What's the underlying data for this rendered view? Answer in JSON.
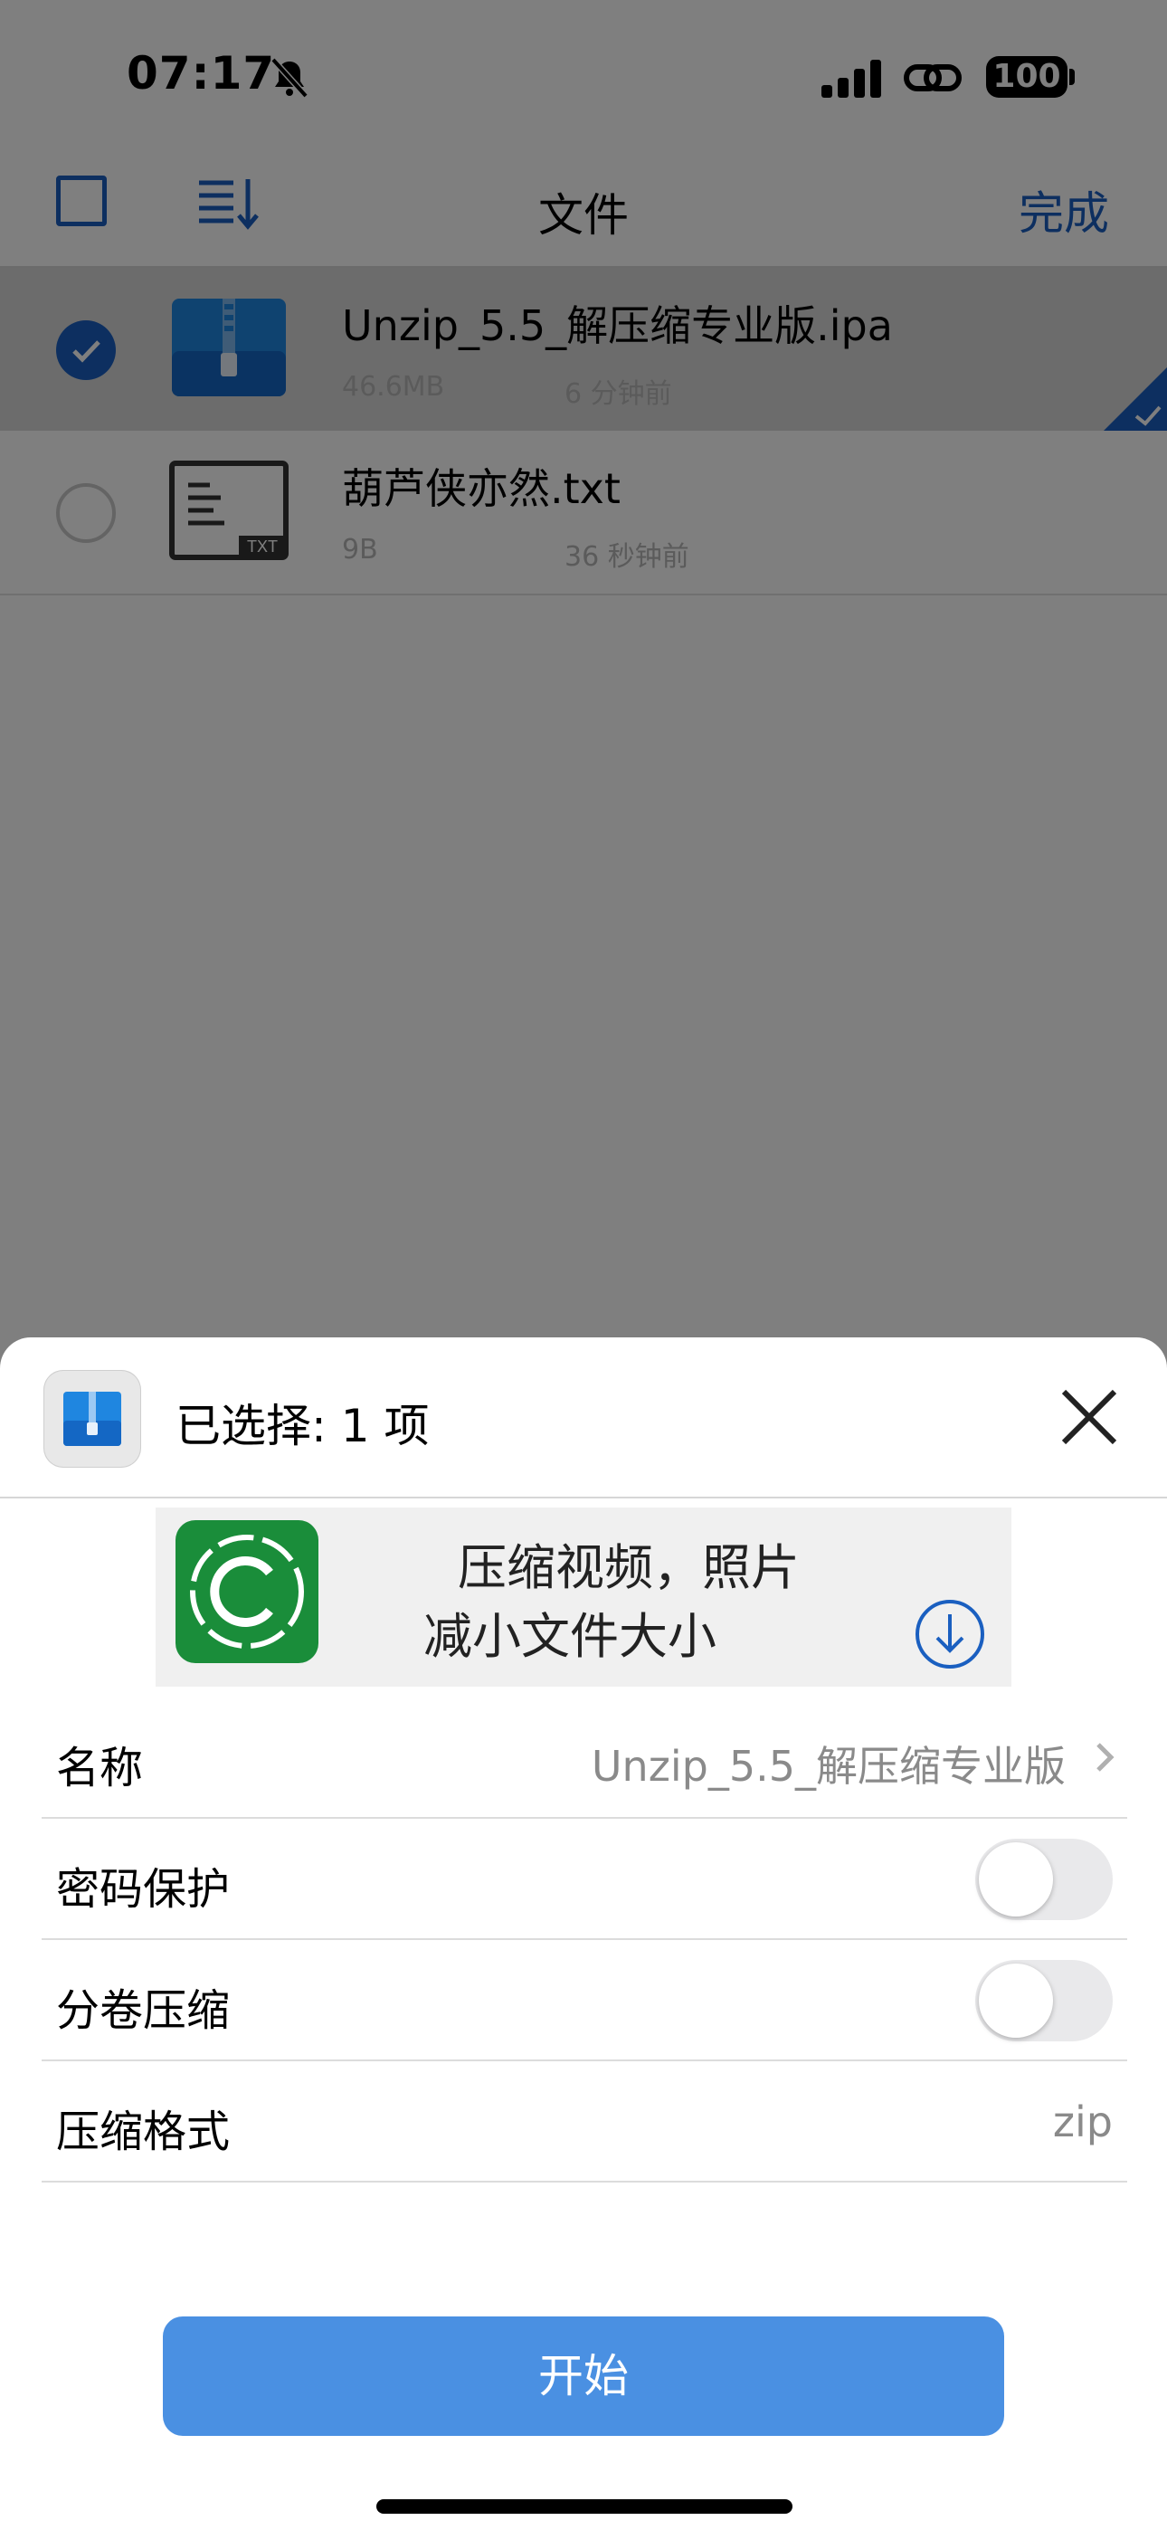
{
  "status_bar": {
    "time": "07:17",
    "battery": "100"
  },
  "nav": {
    "title": "文件",
    "done_label": "完成"
  },
  "files": [
    {
      "name": "Unzip_5.5_解压缩专业版.ipa",
      "size": "46.6MB",
      "modified": "6 分钟前",
      "selected": true,
      "icon": "zip-file-icon"
    },
    {
      "name": "葫芦侠亦然.txt",
      "size": "9B",
      "modified": "36 秒钟前",
      "selected": false,
      "icon": "txt-file-icon",
      "icon_badge": "TXT"
    }
  ],
  "sheet": {
    "title": "已选择: 1 项",
    "ad": {
      "line1": "压缩视频，照片",
      "line2": "减小文件大小"
    },
    "settings": {
      "name": {
        "label": "名称",
        "value": "Unzip_5.5_解压缩专业版"
      },
      "password": {
        "label": "密码保护",
        "enabled": false
      },
      "split": {
        "label": "分卷压缩",
        "enabled": false
      },
      "format": {
        "label": "压缩格式",
        "value": "zip"
      }
    },
    "start_label": "开始"
  },
  "colors": {
    "accent": "#1a5fc0",
    "button": "#4a90e2",
    "ad_green": "#1a8d3a"
  }
}
